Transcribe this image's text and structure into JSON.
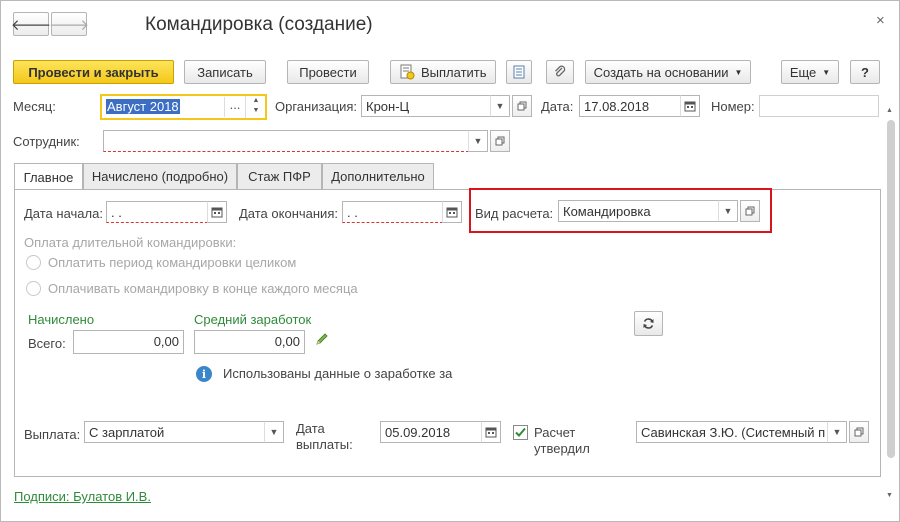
{
  "window": {
    "title": "Командировка (создание)",
    "close_glyph": "×"
  },
  "nav": {
    "back_glyph": "🡐",
    "forward_glyph": "🡒"
  },
  "toolbar": {
    "post_close": "Провести и закрыть",
    "save": "Записать",
    "post": "Провести",
    "pay": "Выплатить",
    "create_based": "Создать на основании",
    "more": "Еще",
    "help": "?"
  },
  "header": {
    "month_label": "Месяц:",
    "month_value": "Август 2018",
    "month_ellipsis": "...",
    "org_label": "Организация:",
    "org_value": "Крон-Ц",
    "date_label": "Дата:",
    "date_value": "17.08.2018",
    "number_label": "Номер:",
    "number_value": "",
    "employee_label": "Сотрудник:",
    "employee_value": ""
  },
  "tabs": [
    {
      "label": "Главное",
      "active": true
    },
    {
      "label": "Начислено (подробно)",
      "active": false
    },
    {
      "label": "Стаж ПФР",
      "active": false
    },
    {
      "label": "Дополнительно",
      "active": false
    }
  ],
  "main": {
    "start_label": "Дата начала:",
    "start_value": " .  .",
    "end_label": "Дата окончания:",
    "end_value": " .  .",
    "calc_kind_label": "Вид расчета:",
    "calc_kind_value": "Командировка",
    "long_trip_label": "Оплата длительной командировки:",
    "radio_whole": "Оплатить период командировки целиком",
    "radio_monthly": "Оплачивать командировку в конце каждого месяца",
    "accrued_header": "Начислено",
    "avg_header": "Средний заработок",
    "total_label": "Всего:",
    "total_value": "0,00",
    "avg_value": "0,00",
    "info_text": "Использованы данные о заработке за",
    "payout_label": "Выплата:",
    "payout_value": "С зарплатой",
    "pay_date_label_1": "Дата",
    "pay_date_label_2": "выплаты:",
    "pay_date_value": "05.09.2018",
    "approved_label_1": "Расчет",
    "approved_label_2": "утвердил",
    "approved_checked": true,
    "approver_value": "Савинская З.Ю. (Системный п"
  },
  "footer": {
    "signatures_link": "Подписи: Булатов И.В."
  },
  "colors": {
    "accent_yellow": "#f4c81a",
    "highlight_red": "#d8141c",
    "green_text": "#2e8b3a",
    "info_blue": "#3a86c8"
  }
}
